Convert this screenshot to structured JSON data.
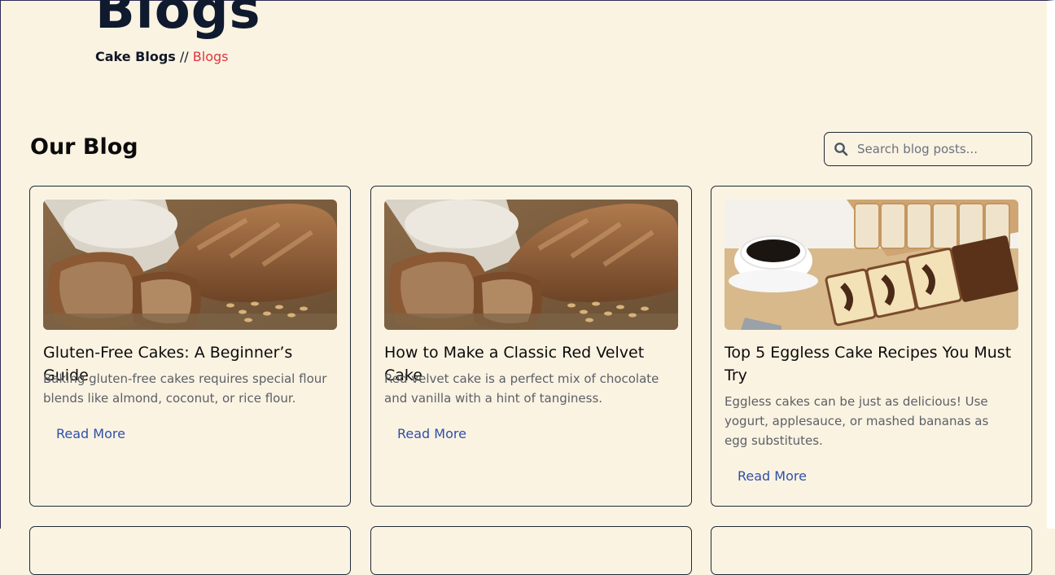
{
  "hero": {
    "title": "Blogs",
    "breadcrumb": {
      "home": "Cake Blogs",
      "separator": " // ",
      "current": "Blogs"
    }
  },
  "section": {
    "title": "Our Blog"
  },
  "search": {
    "placeholder": "Search blog posts...",
    "value": ""
  },
  "posts": [
    {
      "title": "Gluten-Free Cakes: A Beginner’s Guide",
      "description": "Baking gluten-free cakes requires special flour blends like almond, coconut, or rice flour.",
      "link": "Read More",
      "image": "bread-loaves-photo"
    },
    {
      "title": "How to Make a Classic Red Velvet Cake",
      "description": "Red velvet cake is a perfect mix of chocolate and vanilla with a hint of tanginess.",
      "link": "Read More",
      "image": "bread-loaves-photo"
    },
    {
      "title": "Top 5 Eggless Cake Recipes You Must Try",
      "description": "Eggless cakes can be just as delicious! Use yogurt, applesauce, or mashed bananas as egg substitutes.",
      "link": "Read More",
      "image": "marble-cake-coffee-photo"
    }
  ],
  "colors": {
    "background": "#fbf3e2",
    "accent_red": "#e0353e",
    "link_blue": "#2f4fa8",
    "border": "#1f2937"
  }
}
